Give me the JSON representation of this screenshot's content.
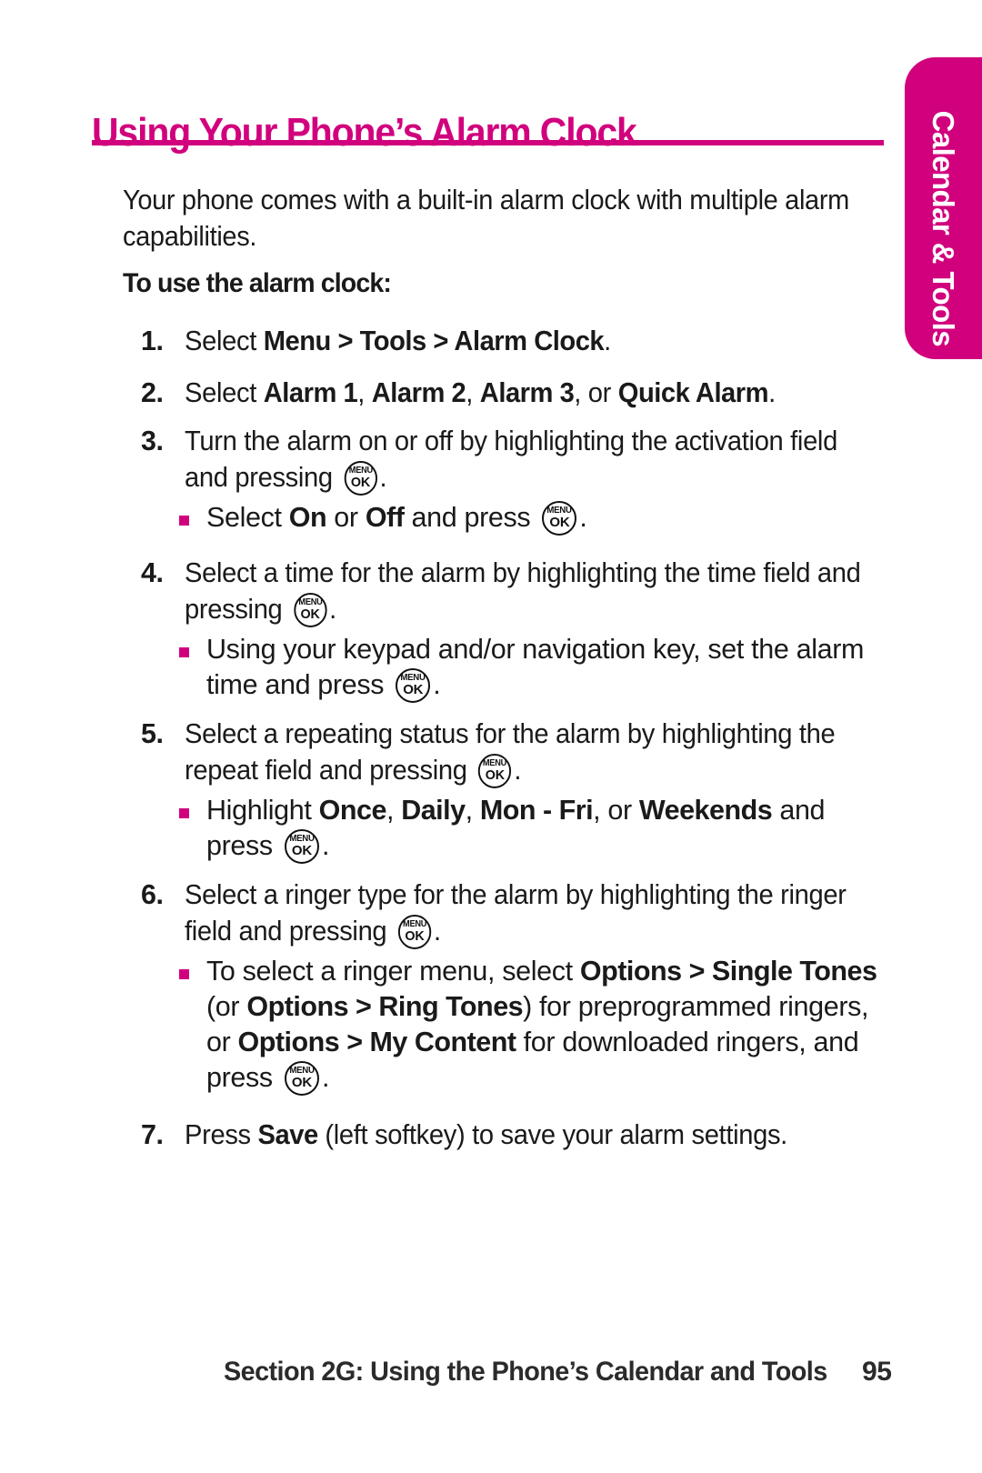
{
  "side_tab": {
    "label": "Calendar & Tools"
  },
  "header": {
    "title": "Using Your Phone’s Alarm Clock",
    "rule_color": "#d1007d"
  },
  "colors": {
    "accent_magenta": "#d1007d",
    "body_text": "#1a1a1a",
    "footer_text": "#2b2b2b",
    "page_background": "#ffffff"
  },
  "icons": {
    "menu_ok_key": {
      "name": "menu-ok-key-icon",
      "top_label": "MENU",
      "bottom_label": "OK"
    },
    "bullet": {
      "name": "square-bullet-icon",
      "shape": "square",
      "color": "#d1007d"
    }
  },
  "body": {
    "intro": "Your phone comes with a built-in alarm clock with multiple alarm capabilities.",
    "lead_in": "To use the alarm clock:"
  },
  "steps": [
    {
      "number": "1.",
      "segments": [
        {
          "t": "Select ",
          "b": false
        },
        {
          "t": "Menu > Tools > Alarm Clock",
          "b": true
        },
        {
          "t": ".",
          "b": false
        }
      ],
      "subs": []
    },
    {
      "number": "2.",
      "segments": [
        {
          "t": "Select ",
          "b": false
        },
        {
          "t": "Alarm 1",
          "b": true
        },
        {
          "t": ", ",
          "b": false
        },
        {
          "t": "Alarm 2",
          "b": true
        },
        {
          "t": ", ",
          "b": false
        },
        {
          "t": "Alarm 3",
          "b": true
        },
        {
          "t": ", or ",
          "b": false
        },
        {
          "t": "Quick Alarm",
          "b": true
        },
        {
          "t": ".",
          "b": false
        }
      ],
      "subs": []
    },
    {
      "number": "3.",
      "segments": [
        {
          "t": "Turn the alarm on or off by highlighting the activation field and pressing ",
          "b": false
        },
        {
          "t": "KEY",
          "b": false,
          "key": true
        },
        {
          "t": ".",
          "b": false
        }
      ],
      "subs": [
        {
          "segments": [
            {
              "t": "Select ",
              "b": false
            },
            {
              "t": "On",
              "b": true
            },
            {
              "t": " or ",
              "b": false
            },
            {
              "t": "Off",
              "b": true
            },
            {
              "t": " and press ",
              "b": false
            },
            {
              "t": "KEY",
              "b": false,
              "key": true
            },
            {
              "t": ".",
              "b": false
            }
          ]
        }
      ]
    },
    {
      "number": "4.",
      "segments": [
        {
          "t": "Select a time for the alarm by highlighting the time field and pressing ",
          "b": false
        },
        {
          "t": "KEY",
          "b": false,
          "key": true
        },
        {
          "t": ".",
          "b": false
        }
      ],
      "subs": [
        {
          "segments": [
            {
              "t": "Using your keypad and/or navigation key, set the alarm time and press ",
              "b": false
            },
            {
              "t": "KEY",
              "b": false,
              "key": true
            },
            {
              "t": ".",
              "b": false
            }
          ]
        }
      ]
    },
    {
      "number": "5.",
      "segments": [
        {
          "t": "Select a repeating status for the alarm by highlighting the repeat field and pressing ",
          "b": false
        },
        {
          "t": "KEY",
          "b": false,
          "key": true
        },
        {
          "t": ".",
          "b": false
        }
      ],
      "subs": [
        {
          "segments": [
            {
              "t": "Highlight ",
              "b": false
            },
            {
              "t": "Once",
              "b": true
            },
            {
              "t": ", ",
              "b": false
            },
            {
              "t": "Daily",
              "b": true
            },
            {
              "t": ", ",
              "b": false
            },
            {
              "t": "Mon - Fri",
              "b": true
            },
            {
              "t": ", or ",
              "b": false
            },
            {
              "t": "Weekends",
              "b": true
            },
            {
              "t": " and press ",
              "b": false
            },
            {
              "t": "KEY",
              "b": false,
              "key": true
            },
            {
              "t": ".",
              "b": false
            }
          ]
        }
      ]
    },
    {
      "number": "6.",
      "segments": [
        {
          "t": "Select a ringer type for the alarm by highlighting the ringer field and pressing ",
          "b": false
        },
        {
          "t": "KEY",
          "b": false,
          "key": true
        },
        {
          "t": ".",
          "b": false
        }
      ],
      "subs": [
        {
          "segments": [
            {
              "t": "To select a ringer menu, select ",
              "b": false
            },
            {
              "t": "Options > Single Tones",
              "b": true
            },
            {
              "t": " (or ",
              "b": false
            },
            {
              "t": "Options > Ring Tones",
              "b": true
            },
            {
              "t": ") for preprogrammed ringers, or ",
              "b": false
            },
            {
              "t": "Options > My Content",
              "b": true
            },
            {
              "t": " for downloaded ringers, and press ",
              "b": false
            },
            {
              "t": "KEY",
              "b": false,
              "key": true
            },
            {
              "t": ".",
              "b": false
            }
          ]
        }
      ]
    },
    {
      "number": "7.",
      "segments": [
        {
          "t": "Press ",
          "b": false
        },
        {
          "t": "Save",
          "b": true
        },
        {
          "t": " (left softkey) to save your alarm settings.",
          "b": false
        }
      ],
      "subs": []
    }
  ],
  "footer": {
    "text": "Section 2G: Using the Phone’s Calendar and Tools",
    "page_number": "95"
  }
}
